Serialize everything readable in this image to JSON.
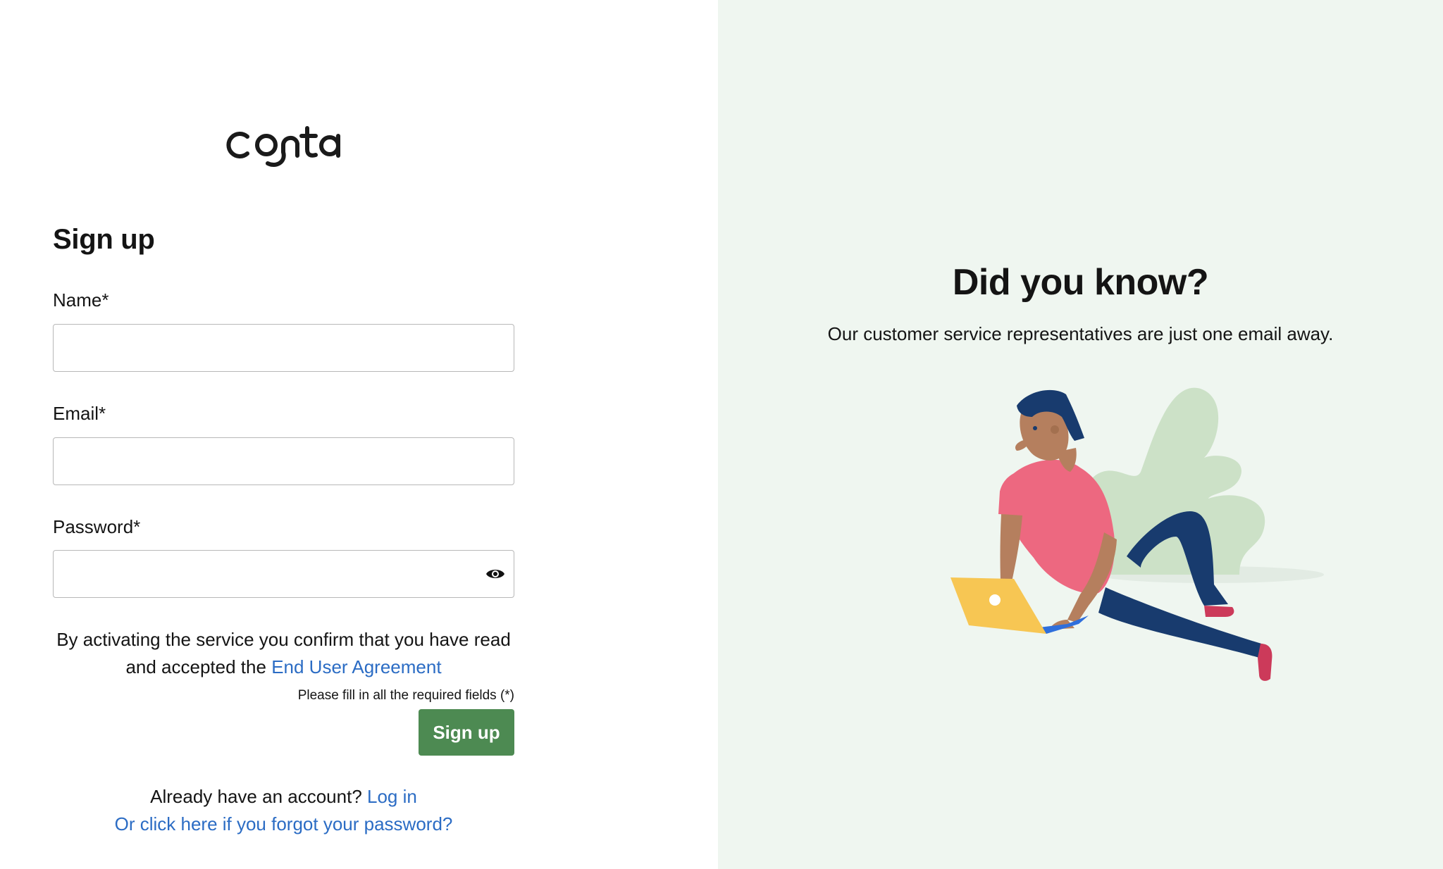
{
  "logo": {
    "text": "conta"
  },
  "form": {
    "title": "Sign up",
    "name": {
      "label": "Name*",
      "value": "",
      "placeholder": ""
    },
    "email": {
      "label": "Email*",
      "value": "",
      "placeholder": ""
    },
    "password": {
      "label": "Password*",
      "value": "",
      "placeholder": "",
      "toggle_icon": "eye-icon"
    },
    "terms_text": "By activating the service you confirm that you have read and accepted the",
    "terms_link": "End User Agreement",
    "required_note": "Please fill in all the required fields (*)",
    "submit_label": "Sign up",
    "account_prompt": "Already have an account?",
    "login_link": "Log in",
    "forgot_link": "Or click here if you forgot your password?"
  },
  "promo": {
    "title": "Did you know?",
    "body": "Our customer service representatives are just one email away.",
    "illustration": "person-with-laptop-illustration"
  },
  "colors": {
    "primary_button": "#4d8a52",
    "link": "#2b6cc4",
    "promo_background": "#eff6f0",
    "text": "#141414"
  }
}
